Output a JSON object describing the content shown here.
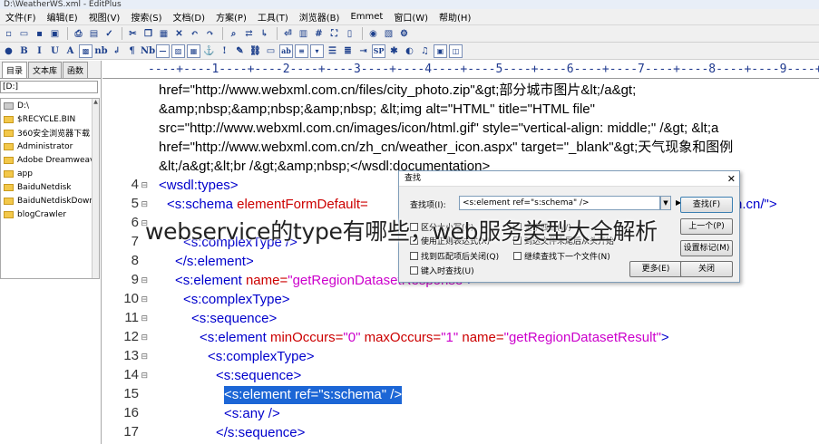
{
  "window": {
    "title": "D:\\WeatherWS.xml - EditPlus"
  },
  "menu": [
    "文件(F)",
    "编辑(E)",
    "视图(V)",
    "搜索(S)",
    "文档(D)",
    "方案(P)",
    "工具(T)",
    "浏览器(B)",
    "Emmet",
    "窗口(W)",
    "帮助(H)"
  ],
  "sidebar": {
    "tabs": [
      "目录",
      "文本库",
      "函数"
    ],
    "drive": "[D:]",
    "items": [
      "D:\\",
      "$RECYCLE.BIN",
      "360安全浏览器下载",
      "Administrator",
      "Adobe Dreamweaver",
      "app",
      "BaiduNetdisk",
      "BaiduNetdiskDownload",
      "blogCrawler"
    ]
  },
  "ruler": "----+----1----+----2----+----3----+----4----+----5----+----6----+----7----+----8----+----9----+----",
  "code": {
    "wrap_lines": [
      "href=\"http://www.webxml.com.cn/files/city_photo.zip\"&gt;部分城市图片&lt;/a&gt;",
      "&amp;nbsp;&amp;nbsp;&amp;nbsp; &lt;img alt=\"HTML\" title=\"HTML file\"",
      "src=\"http://www.webxml.com.cn/images/icon/html.gif\" style=\"vertical-align: middle;\" /&gt; &lt;a",
      "href=\"http://www.webxml.com.cn/zh_cn/weather_icon.aspx\" target=\"_blank\"&gt;天气现象和图例",
      "&lt;/a&gt;&lt;br /&gt;&amp;nbsp;</wsdl:documentation>"
    ],
    "numbers": [
      "4",
      "5",
      "6",
      "7",
      "8",
      "9",
      "10",
      "11",
      "12",
      "13",
      "14",
      "15",
      "16",
      "17"
    ],
    "line4": "<wsdl:types>",
    "line5_tag": "<s:schema",
    "line5_attr": " elementFormDefault=",
    "line5_tail": "n.cn/\">",
    "line7": "<s:complexType />",
    "line8": "</s:element>",
    "line9_tag": "<s:element",
    "line9_attr": " name=",
    "line9_val": "\"getRegionDatasetResponse\"",
    "line9_end": ">",
    "line10": "<s:complexType>",
    "line11": "<s:sequence>",
    "line12_tag": "<s:element",
    "line12_a1": " minOccurs=",
    "line12_v1": "\"0\"",
    "line12_a2": " maxOccurs=",
    "line12_v2": "\"1\"",
    "line12_a3": " name=",
    "line12_v3": "\"getRegionDatasetResult\"",
    "line12_end": ">",
    "line13": "<s:complexType>",
    "line14": "<s:sequence>",
    "line15": "<s:element ref=\"s:schema\" />",
    "line16": "<s:any />",
    "line17": "</s:sequence>"
  },
  "dialog": {
    "title": "查找",
    "find_label": "查找项(I):",
    "find_value": "<s:element ref=\"s:schema\" />",
    "buttons": {
      "find": "查找(F)",
      "prev": "上一个(P)",
      "mark": "设置标记(M)",
      "more": "更多(E)",
      "close": "关闭"
    },
    "options": {
      "find_close": "找到匹配项后关闭(Q)",
      "continue": "继续查找下一个文件(N)",
      "wrap": "键入时查找(U)",
      "case": "区分大小写(C)",
      "regex": "使用正则表达式(X)",
      "whole": "全字匹配(W)",
      "all": "到达文件末尾后从头开始"
    }
  },
  "watermark": "webservice的type有哪些，web服务类型大全解析"
}
